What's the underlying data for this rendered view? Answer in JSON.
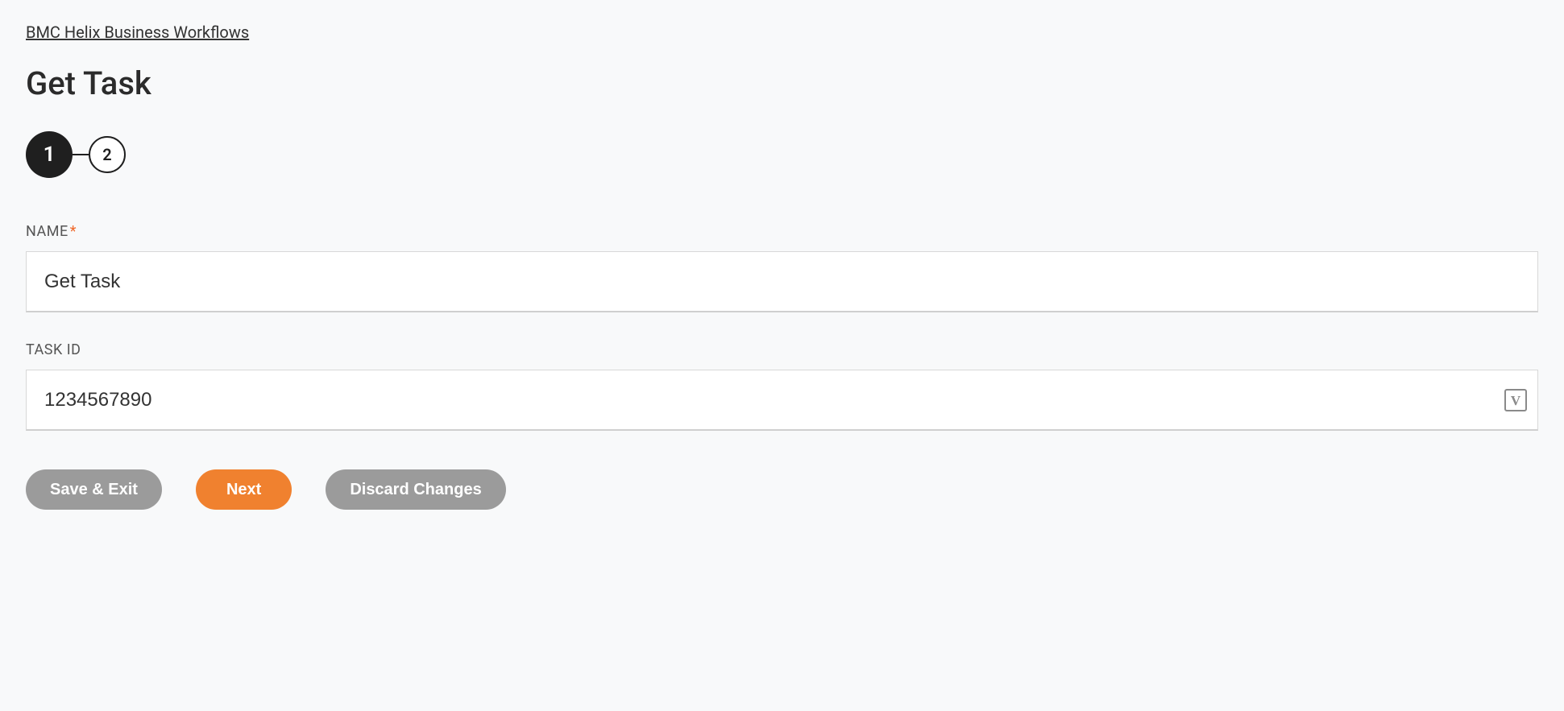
{
  "breadcrumb": "BMC Helix Business Workflows",
  "pageTitle": "Get Task",
  "stepper": {
    "steps": [
      "1",
      "2"
    ],
    "activeIndex": 0
  },
  "form": {
    "name": {
      "label": "NAME",
      "required": true,
      "value": "Get Task"
    },
    "taskId": {
      "label": "TASK ID",
      "required": false,
      "value": "1234567890",
      "iconGlyph": "V"
    }
  },
  "actions": {
    "saveExit": "Save & Exit",
    "next": "Next",
    "discard": "Discard Changes"
  }
}
